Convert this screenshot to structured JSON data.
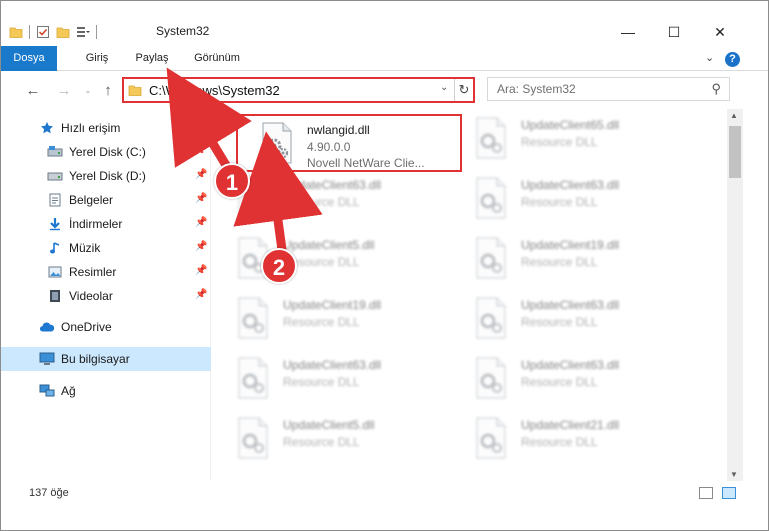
{
  "window": {
    "title": "System32",
    "controls": {
      "minimize": "—",
      "maximize": "☐",
      "close": "✕"
    }
  },
  "ribbon": {
    "tabs": [
      "Dosya",
      "Giriş",
      "Paylaş",
      "Görünüm"
    ],
    "expand_symbol": "⌄",
    "help_symbol": "?"
  },
  "address_bar": {
    "path": "C:\\Windows\\System32",
    "dropdown_symbol": "⌄",
    "refresh_symbol": "↻"
  },
  "search": {
    "placeholder": "Ara: System32",
    "icon": "search-icon",
    "icon_glyph": "⚲"
  },
  "nav_buttons": {
    "back": "←",
    "forward": "→",
    "recent": "⌄",
    "up": "↑"
  },
  "nav_pane": {
    "quick_access": "Hızlı erişim",
    "items": [
      {
        "label": "Yerel Disk (C:)",
        "icon": "drive-icon",
        "pinned": true
      },
      {
        "label": "Yerel Disk (D:)",
        "icon": "drive-icon",
        "pinned": true
      },
      {
        "label": "Belgeler",
        "icon": "documents-icon",
        "pinned": true
      },
      {
        "label": "İndirmeler",
        "icon": "downloads-icon",
        "pinned": true
      },
      {
        "label": "Müzik",
        "icon": "music-icon",
        "pinned": true
      },
      {
        "label": "Resimler",
        "icon": "pictures-icon",
        "pinned": true
      },
      {
        "label": "Videolar",
        "icon": "videos-icon",
        "pinned": true
      }
    ],
    "onedrive": "OneDrive",
    "this_pc": "Bu bilgisayar",
    "network": "Ağ",
    "pin_symbol": "📌"
  },
  "files": {
    "highlighted": {
      "name": "nwlangid.dll",
      "version": "4.90.0.0",
      "description": "Novell NetWare Clie..."
    },
    "left_column": [
      {
        "name": "UpdateClient63.dll",
        "type": "Resource DLL"
      },
      {
        "name": "UpdateClient5.dll",
        "type": "Resource DLL"
      },
      {
        "name": "UpdateClient19.dll",
        "type": "Resource DLL"
      },
      {
        "name": "UpdateClient63.dll",
        "type": "Resource DLL"
      },
      {
        "name": "UpdateClient5.dll",
        "type": "Resource DLL"
      }
    ],
    "right_column": [
      {
        "name": "UpdateClient65.dll",
        "type": "Resource DLL"
      },
      {
        "name": "UpdateClient63.dll",
        "type": "Resource DLL"
      },
      {
        "name": "UpdateClient19.dll",
        "type": "Resource DLL"
      },
      {
        "name": "UpdateClient63.dll",
        "type": "Resource DLL"
      },
      {
        "name": "UpdateClient63.dll",
        "type": "Resource DLL"
      },
      {
        "name": "UpdateClient21.dll",
        "type": "Resource DLL"
      }
    ]
  },
  "status_bar": {
    "item_count": "137 öğe"
  },
  "annotations": {
    "step1": "1",
    "step2": "2"
  },
  "colors": {
    "accent": "#1979ca",
    "highlight": "#e03232",
    "selection": "#cce8ff"
  }
}
